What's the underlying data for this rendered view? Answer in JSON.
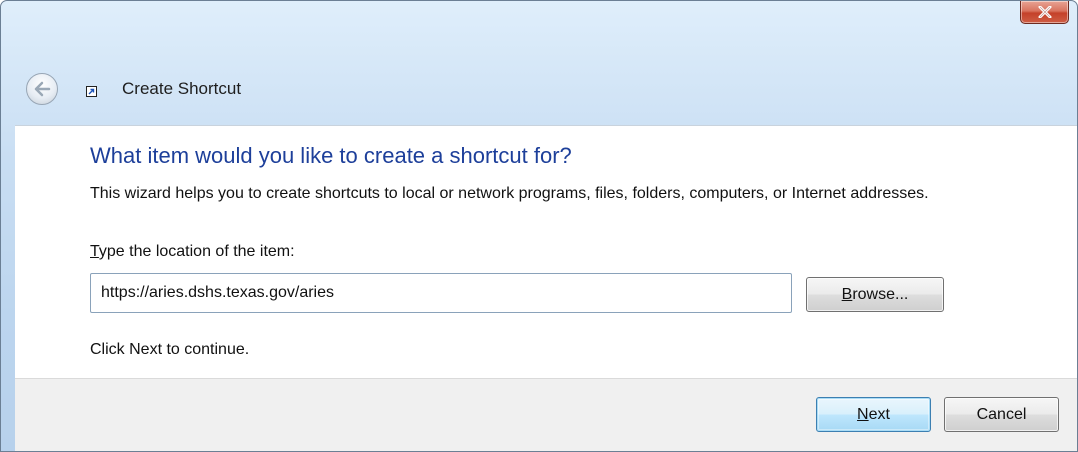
{
  "window": {
    "title": "Create Shortcut",
    "close_symbol": "X"
  },
  "icons": {
    "back": "back-arrow-icon",
    "shortcut": "shortcut-overlay-icon",
    "close": "close-icon"
  },
  "page": {
    "heading": "What item would you like to create a shortcut for?",
    "description": "This wizard helps you to create shortcuts to local or network programs, files, folders, computers, or Internet addresses.",
    "location_label_accel": "T",
    "location_label_rest": "ype the location of the item:",
    "location_value": "https://aries.dshs.texas.gov/aries",
    "browse_accel": "B",
    "browse_prefix": "",
    "browse_rest": "rowse...",
    "hint": "Click Next to continue."
  },
  "footer": {
    "next_accel": "N",
    "next_rest": "ext",
    "cancel_label": "Cancel"
  },
  "colors": {
    "heading": "#1d3f9a",
    "titlebar": "#bcd5ee",
    "close_button": "#c4412a",
    "default_button": "#bee6fd"
  }
}
